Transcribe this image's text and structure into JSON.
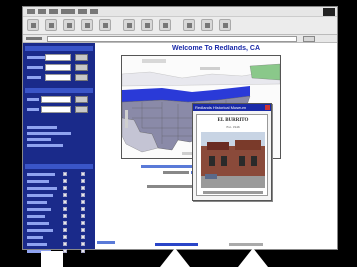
{
  "page": {
    "title": "Welcome To Redlands, CA"
  },
  "popup": {
    "window_title": "Redlands Historical Museum",
    "heading": "EL BURRITO",
    "subheading": "Est. 1946"
  },
  "colors": {
    "sidebar_bg": "#1a2a8a",
    "title_blue": "#1a2aa8",
    "map_purple": "#8a8aa8",
    "map_river": "#2a3ad8",
    "map_green": "#8ac88a"
  },
  "icons": [
    "back-icon",
    "forward-icon",
    "stop-icon",
    "refresh-icon",
    "home-icon",
    "search-icon",
    "favorites-icon",
    "history-icon",
    "mail-icon",
    "print-icon",
    "edit-icon"
  ]
}
